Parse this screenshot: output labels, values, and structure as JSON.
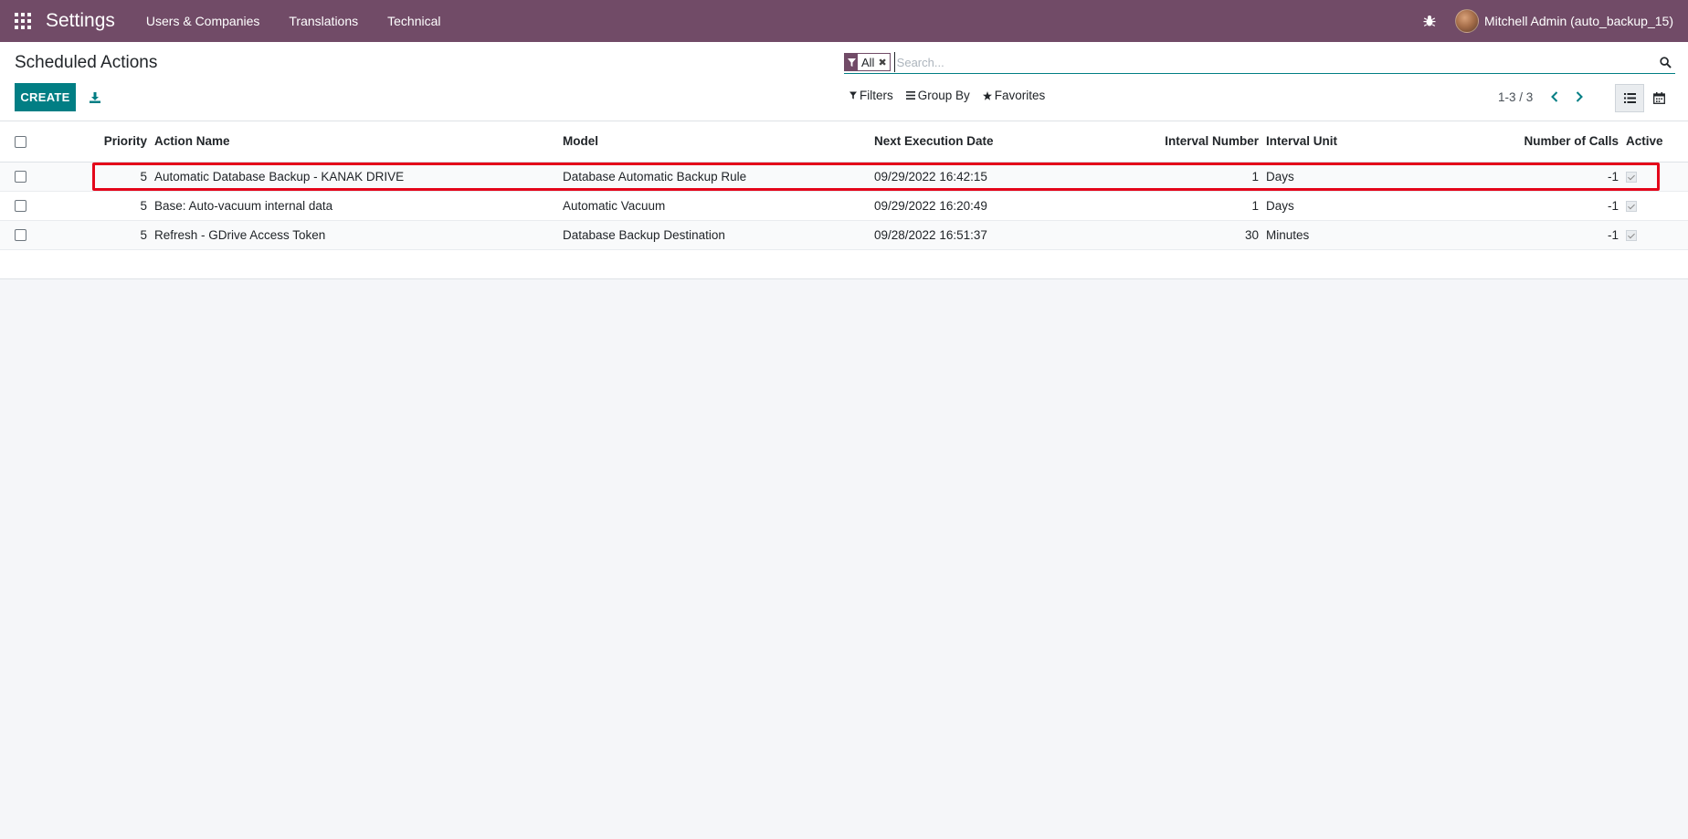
{
  "navbar": {
    "brand": "Settings",
    "menu": [
      "Users & Companies",
      "Translations",
      "Technical"
    ],
    "user": "Mitchell Admin (auto_backup_15)",
    "color": "#714b67"
  },
  "control_panel": {
    "title": "Scheduled Actions",
    "create_label": "CREATE",
    "search": {
      "facet_value": "All",
      "placeholder": "Search..."
    },
    "filters_label": "Filters",
    "group_by_label": "Group By",
    "favorites_label": "Favorites",
    "pager": "1-3 / 3",
    "accent_color": "#017e84"
  },
  "table": {
    "columns": [
      "Priority",
      "Action Name",
      "Model",
      "Next Execution Date",
      "Interval Number",
      "Interval Unit",
      "Number of Calls",
      "Active"
    ],
    "rows": [
      {
        "priority": "5",
        "name": "Automatic Database Backup - KANAK DRIVE",
        "model": "Database Automatic Backup Rule",
        "next_date": "09/29/2022 16:42:15",
        "interval_number": "1",
        "interval_unit": "Days",
        "calls": "-1",
        "active": true
      },
      {
        "priority": "5",
        "name": "Base: Auto-vacuum internal data",
        "model": "Automatic Vacuum",
        "next_date": "09/29/2022 16:20:49",
        "interval_number": "1",
        "interval_unit": "Days",
        "calls": "-1",
        "active": true
      },
      {
        "priority": "5",
        "name": "Refresh - GDrive Access Token",
        "model": "Database Backup Destination",
        "next_date": "09/28/2022 16:51:37",
        "interval_number": "30",
        "interval_unit": "Minutes",
        "calls": "-1",
        "active": true
      }
    ]
  }
}
